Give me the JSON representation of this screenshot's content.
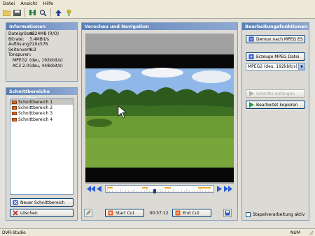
{
  "menu": [
    "Datei",
    "Ansicht",
    "Hilfe"
  ],
  "toolbar": {
    "icons": [
      "open-folder-icon",
      "save-icon",
      "cut-icon",
      "search-icon",
      "upload-icon",
      "help-icon"
    ]
  },
  "info_panel": {
    "title": "Informationen",
    "rows": [
      {
        "key": "Dateigrösse:",
        "value": "4324MB (R/O)"
      },
      {
        "key": "Bitrate:",
        "value": "3.4MBit/s"
      },
      {
        "key": "Auflösung:",
        "value": "720x576"
      },
      {
        "key": "Seitenverh.:",
        "value": "4:3"
      },
      {
        "key": "Tonspuren:",
        "value": ""
      },
      {
        "key": "MPEG2",
        "value": "(deu, 192kbit/s)"
      },
      {
        "key": "AC3 2.0",
        "value": "(deu, 448kbit/s)"
      }
    ]
  },
  "segments_panel": {
    "title": "Schnittbereiche bearbeiten",
    "items": [
      "Schnittbereich 1",
      "Schnittbereich 2",
      "Schnittbereich 3",
      "Schnittbereich 4"
    ],
    "selected_index": 0,
    "new_button": "Neuer Schnittbereich",
    "delete_button": "Löschen"
  },
  "preview_panel": {
    "title": "Vorschau und Navigation",
    "start_cut": "Start Cut",
    "end_cut": "End Cut",
    "timecode": "00:37:12",
    "position_fraction": 0.44
  },
  "edit_panel": {
    "title": "Bearbeitungsfunktionen",
    "demux_button": "Demux nach MPEG ES",
    "create_button": "Erzeuge MPEG Datei",
    "format_select": "MPEG2 (deu, 192kbit/s)",
    "start_cut_disabled": "Schnitte anfangen",
    "copy_button": "Bearbeitet kopieren",
    "batch_checkbox": "Stapelverarbeitung aktiv",
    "batch_checked": false
  },
  "statusbar": {
    "left": "DVR-Studio",
    "right": "NUM"
  },
  "colors": {
    "panel_title": "#6a8dbf",
    "accent_orange": "#f0a830",
    "nav_blue": "#2a5bd8"
  }
}
